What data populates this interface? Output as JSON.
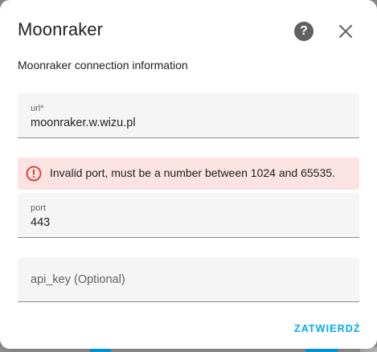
{
  "dialog": {
    "title": "Moonraker",
    "subtitle": "Moonraker connection information",
    "help_icon": "help-circle-icon",
    "close_icon": "close-icon"
  },
  "fields": {
    "url": {
      "label": "url*",
      "value": "moonraker.w.wizu.pl"
    },
    "port": {
      "label": "port",
      "value": "443"
    },
    "api_key": {
      "placeholder": "api_key (Optional)",
      "value": ""
    }
  },
  "error": {
    "icon": "alert-circle-icon",
    "message": "Invalid port, must be a number between 1024 and 65535."
  },
  "actions": {
    "submit_label": "ZATWIERDŹ"
  },
  "colors": {
    "accent": "#03a9f4",
    "error": "#db4437",
    "error_bg": "#fbe3e3"
  }
}
